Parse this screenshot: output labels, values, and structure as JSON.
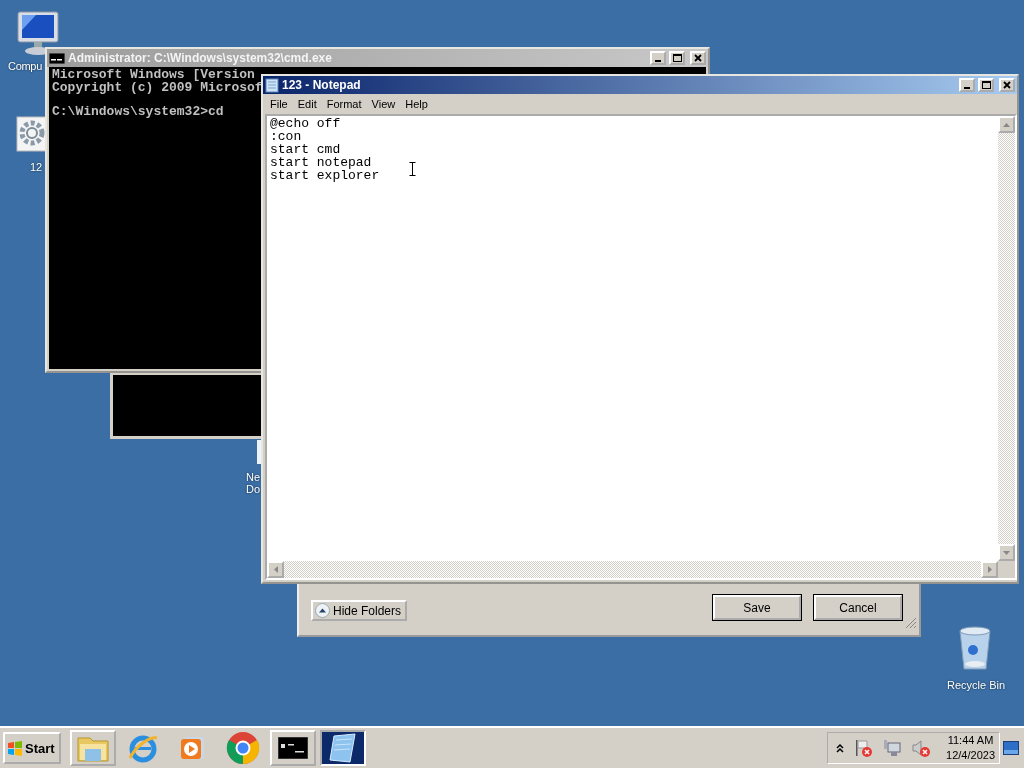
{
  "desktop_icons": [
    {
      "kind": "computer",
      "label": "Compu"
    },
    {
      "kind": "settings-file",
      "label": "12"
    },
    {
      "kind": "document",
      "label_lines": [
        "Ne",
        "Do"
      ]
    },
    {
      "kind": "recycle-bin",
      "label": "Recycle Bin"
    }
  ],
  "cmd_window": {
    "title": "Administrator: C:\\Windows\\system32\\cmd.exe",
    "output": [
      "Microsoft Windows [Version",
      "Copyright (c) 2009 Microsof"
    ],
    "prompt": "C:\\Windows\\system32>cd"
  },
  "notepad": {
    "title": "123 - Notepad",
    "menu": [
      "File",
      "Edit",
      "Format",
      "View",
      "Help"
    ],
    "lines": [
      "@echo off",
      ":con",
      "start cmd",
      "start notepad",
      "start explorer"
    ]
  },
  "save_dialog": {
    "toggle_button": "Hide Folders",
    "buttons": [
      "Save",
      "Cancel"
    ]
  },
  "taskbar": {
    "start": "Start",
    "apps": [
      {
        "kind": "folder",
        "running": true,
        "selected": false
      },
      {
        "kind": "ie",
        "running": false,
        "selected": false
      },
      {
        "kind": "media",
        "running": false,
        "selected": false
      },
      {
        "kind": "chrome",
        "running": false,
        "selected": false
      },
      {
        "kind": "console",
        "running": true,
        "selected": false
      },
      {
        "kind": "notepad",
        "running": true,
        "selected": true
      }
    ],
    "time": "11:44 AM",
    "date": "12/4/2023"
  }
}
